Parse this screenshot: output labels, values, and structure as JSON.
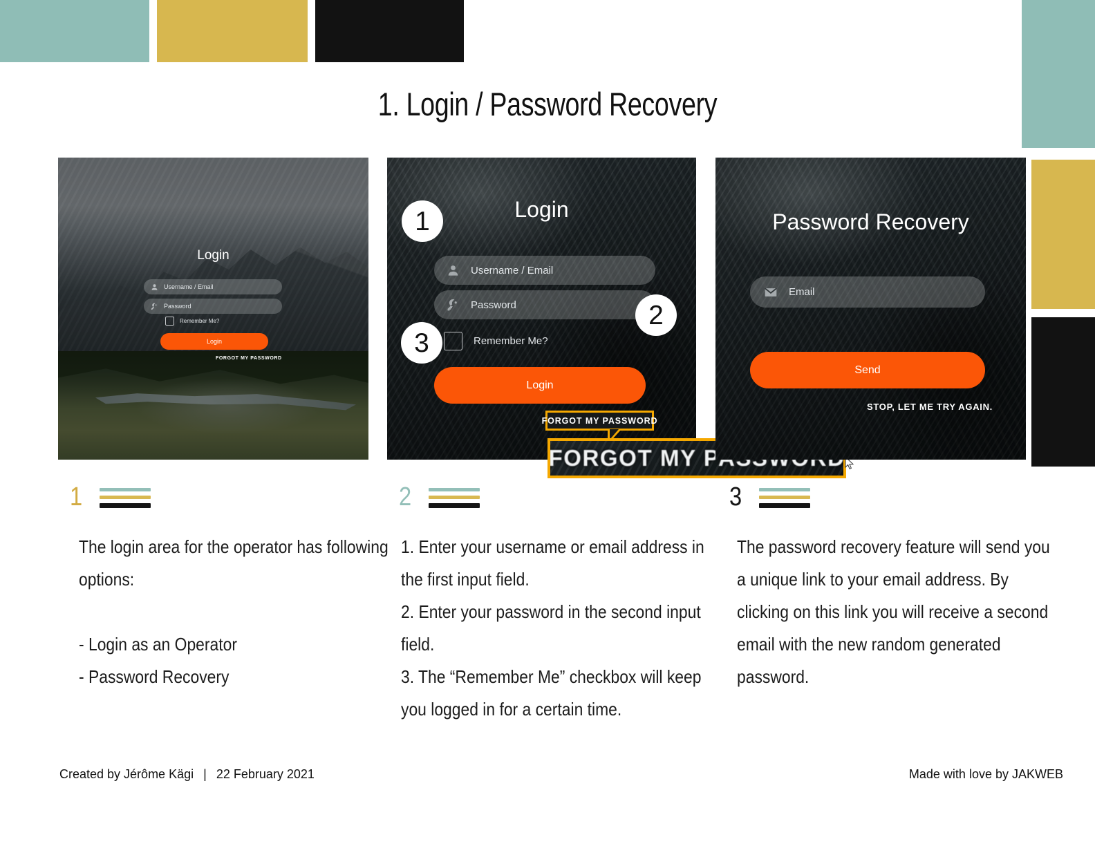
{
  "title": "1. Login / Password Recovery",
  "palette": {
    "teal": "#8fbdb6",
    "gold": "#d7b74f",
    "black": "#121212",
    "orange": "#FB5607",
    "highlight_yellow": "#F5A800"
  },
  "panels": [
    {
      "name": "login-small",
      "heading": "Login",
      "fields": [
        {
          "icon": "user-icon",
          "placeholder": "Username / Email"
        },
        {
          "icon": "key-icon",
          "placeholder": "Password"
        }
      ],
      "checkbox_label": "Remember Me?",
      "button_label": "Login",
      "link_label": "FORGOT MY PASSWORD"
    },
    {
      "name": "login-annotated",
      "heading": "Login",
      "fields": [
        {
          "icon": "user-icon",
          "placeholder": "Username / Email"
        },
        {
          "icon": "key-icon",
          "placeholder": "Password"
        }
      ],
      "checkbox_label": "Remember Me?",
      "button_label": "Login",
      "link_label": "FORGOT MY PASSWORD",
      "callouts": [
        "1",
        "2",
        "3"
      ],
      "magnified_label": "FORGOT MY PASSWORD"
    },
    {
      "name": "password-recovery",
      "heading": "Password Recovery",
      "fields": [
        {
          "icon": "envelope-icon",
          "placeholder": "Email"
        }
      ],
      "button_label": "Send",
      "link_label": "STOP, LET ME TRY AGAIN."
    }
  ],
  "steps": [
    {
      "number": "1",
      "number_color": "#d2ab42",
      "body": "The login area for the operator has following options:\n\n- Login as an Operator\n- Password Recovery"
    },
    {
      "number": "2",
      "number_color": "#93bfb8",
      "body": "1. Enter your username or email address in the first input field.\n2. Enter your password in the second input field.\n3. The “Remember Me” checkbox will keep you logged in for a certain time."
    },
    {
      "number": "3",
      "number_color": "#151515",
      "body": "The password recovery feature will send you a unique link to your email address. By clicking on this link you will receive a second email with the new random generated password."
    }
  ],
  "footer": {
    "author": "Created by Jérôme Kägi",
    "separator": "|",
    "date": "22 February 2021",
    "credit": "Made with love by JAKWEB"
  }
}
